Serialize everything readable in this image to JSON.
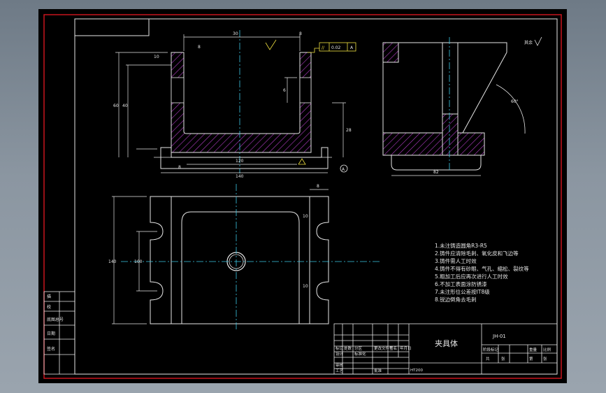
{
  "colors": {
    "sheet_bg": "#000000",
    "border_red": "#c8141e",
    "line_white": "#ffffff",
    "hatch_magenta": "#b43cc8",
    "center_cyan": "#3cc8e6",
    "annot_yellow": "#f0e040",
    "part_outline": "#e6e6e6"
  },
  "title_block": {
    "part_name": "夹具体",
    "code": "JH-01",
    "scale_row_labels": [
      "设计",
      "审核",
      "标准化",
      "工艺",
      "批准"
    ],
    "small_cells": [
      "标记",
      "处数",
      "分区",
      "更改文件号",
      "签名",
      "年月日"
    ],
    "right_header": [
      "阶段标记",
      "重量",
      "比例"
    ],
    "sheet_info": [
      "共",
      "张",
      "第",
      "张"
    ],
    "material": "HT200"
  },
  "left_strip": {
    "rows": [
      "描",
      "校",
      "底图总号",
      "日期",
      "签名"
    ]
  },
  "technical_requirements": {
    "lines": [
      "1.未注铸造圆角R3-R5",
      "2.铸件应清除毛刺、氧化皮和飞边等",
      "3.铸件需人工时效",
      "4.铸件不得有砂眼、气孔、缩松、裂纹等",
      "5.粗加工后应再次进行人工时效",
      "6.不加工表面涂防锈漆",
      "7.未注形位公差按IT8级",
      "8.锐边倒角去毛刺"
    ]
  },
  "annotations": {
    "roughness_note": "其余",
    "angle": "60°",
    "tolerance_frame": [
      "//",
      "0.02",
      "A"
    ],
    "datum": "A",
    "dims_front": [
      "30",
      "8",
      "10",
      "8",
      "6",
      "28",
      "40",
      "60",
      "120",
      "140",
      "8"
    ],
    "dims_side": [
      "82"
    ],
    "dims_top": [
      "8",
      "100",
      "140",
      "10",
      "10"
    ]
  }
}
